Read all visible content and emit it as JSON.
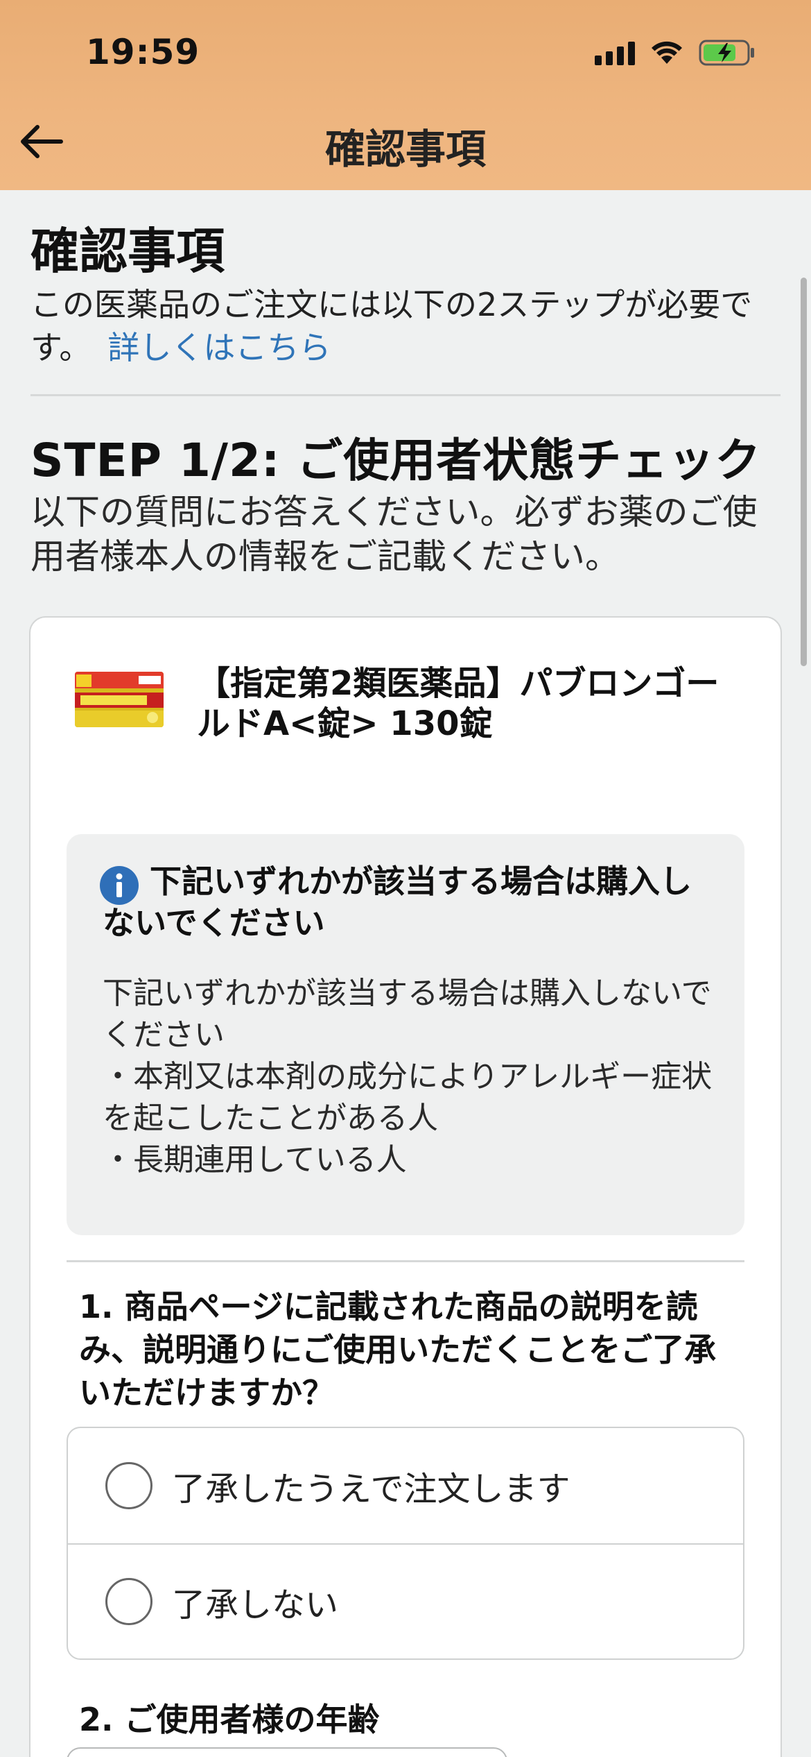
{
  "status_bar": {
    "time": "19:59"
  },
  "nav": {
    "title": "確認事項",
    "back_icon": "back-arrow-icon"
  },
  "page": {
    "heading": "確認事項",
    "intro_text": "この医薬品のご注文には以下の2ステップが必要です。",
    "intro_link": "詳しくはこちら"
  },
  "step": {
    "title": "STEP 1/2: ご使用者状態チェック",
    "description": "以下の質問にお答えください。必ずお薬のご使用者様本人の情報をご記載ください。"
  },
  "product": {
    "name": "【指定第2類医薬品】パブロンゴールドA<錠> 130錠"
  },
  "warning": {
    "title": "下記いずれかが該当する場合は購入しないでください",
    "body": " 下記いずれかが該当する場合は購入しないでください\n・本剤又は本剤の成分によりアレルギー症状を起こしたことがある人\n・長期連用している人"
  },
  "question1": {
    "text": "1. 商品ページに記載された商品の説明を読み、説明通りにご使用いただくことをご了承いただけますか？",
    "options": [
      "了承したうえで注文します",
      "了承しない"
    ]
  },
  "question2": {
    "text": "2. ご使用者様の年齢"
  },
  "colors": {
    "header_bg": "#eeb57f",
    "link": "#2f74b8",
    "info_icon": "#2f6fb8",
    "battery_charging": "#5cc94a"
  }
}
